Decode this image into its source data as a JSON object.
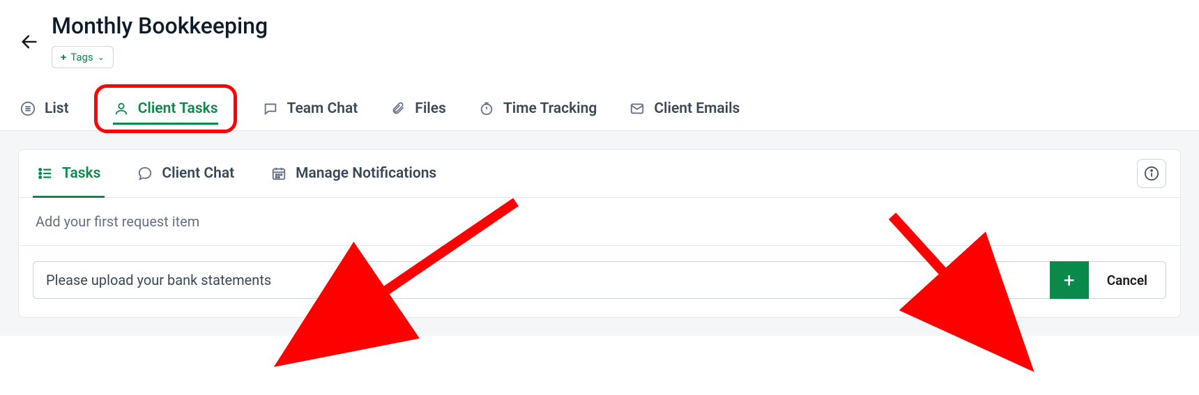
{
  "header": {
    "title": "Monthly Bookkeeping",
    "tags_label": "Tags"
  },
  "main_tabs": [
    {
      "label": "List",
      "icon": "list-icon"
    },
    {
      "label": "Client Tasks",
      "icon": "person-icon",
      "active": true
    },
    {
      "label": "Team Chat",
      "icon": "chat-icon"
    },
    {
      "label": "Files",
      "icon": "attachment-icon"
    },
    {
      "label": "Time Tracking",
      "icon": "timer-icon"
    },
    {
      "label": "Client Emails",
      "icon": "mail-icon"
    }
  ],
  "sub_tabs": [
    {
      "label": "Tasks",
      "icon": "tasks-icon",
      "active": true
    },
    {
      "label": "Client Chat",
      "icon": "chat-bubble-icon"
    },
    {
      "label": "Manage Notifications",
      "icon": "calendar-icon"
    }
  ],
  "panel": {
    "prompt": "Add your first request item",
    "input_value": "Please upload your bank statements",
    "cancel_label": "Cancel"
  },
  "colors": {
    "accent": "#0a8a4a",
    "annotation": "#ff0000"
  }
}
